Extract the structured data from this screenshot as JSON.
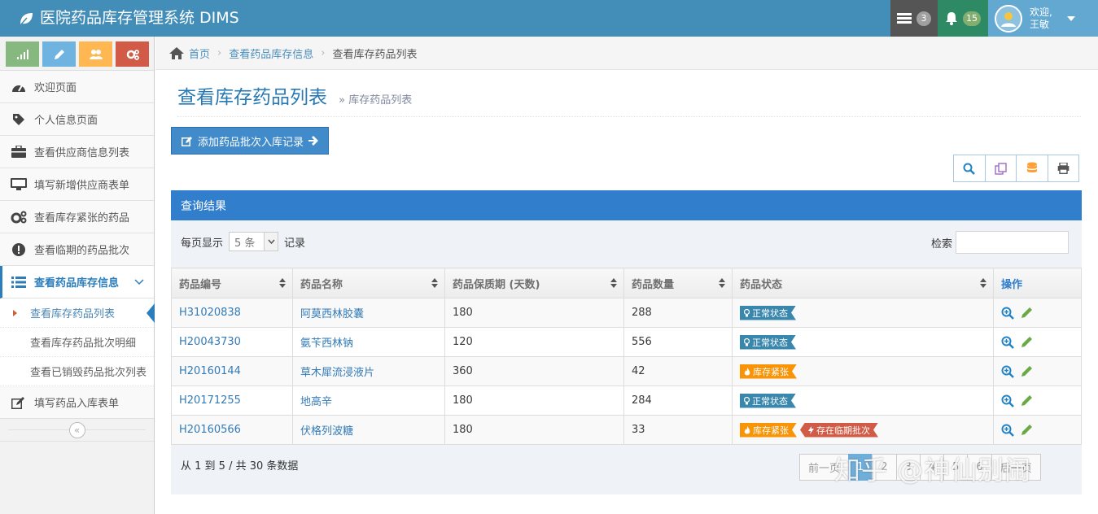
{
  "app": {
    "title": "医院药品库存管理系统 DIMS",
    "tasks_count": "3",
    "notifications_count": "15",
    "user_greeting": "欢迎,",
    "user_name": "王敏"
  },
  "sidebar": {
    "items": [
      {
        "label": "欢迎页面",
        "icon": "dashboard-icon"
      },
      {
        "label": "个人信息页面",
        "icon": "tag-icon"
      },
      {
        "label": "查看供应商信息列表",
        "icon": "briefcase-icon"
      },
      {
        "label": "填写新增供应商表单",
        "icon": "desktop-icon"
      },
      {
        "label": "查看库存紧张的药品",
        "icon": "cogs-icon"
      },
      {
        "label": "查看临期的药品批次",
        "icon": "exclamation-icon"
      },
      {
        "label": "查看药品库存信息",
        "icon": "list-icon"
      },
      {
        "label": "填写药品入库表单",
        "icon": "edit-icon"
      }
    ],
    "subitems": [
      {
        "label": "查看库存药品列表"
      },
      {
        "label": "查看库存药品批次明细"
      },
      {
        "label": "查看已销毁药品批次列表"
      }
    ],
    "collapse_glyph": "«"
  },
  "breadcrumb": {
    "home": "首页",
    "level1": "查看药品库存信息",
    "current": "查看库存药品列表"
  },
  "page": {
    "title": "查看库存药品列表",
    "subtitle": "» 库存药品列表",
    "add_button": "添加药品批次入库记录"
  },
  "panel": {
    "title": "查询结果",
    "length_prefix": "每页显示",
    "length_value": "5 条",
    "length_suffix": "记录",
    "search_label": "检索",
    "search_value": "",
    "info": "从 1 到 5 / 共 30 条数据"
  },
  "table": {
    "headers": [
      "药品编号",
      "药品名称",
      "药品保质期 (天数)",
      "药品数量",
      "药品状态",
      "操作"
    ],
    "rows": [
      {
        "code": "H31020838",
        "name": "阿莫西林胶囊",
        "shelf": "180",
        "qty": "288",
        "tags": [
          "正常状态"
        ]
      },
      {
        "code": "H20043730",
        "name": "氨苄西林钠",
        "shelf": "120",
        "qty": "556",
        "tags": [
          "正常状态"
        ]
      },
      {
        "code": "H20160144",
        "name": "草木犀流浸液片",
        "shelf": "360",
        "qty": "42",
        "tags": [
          "库存紧张"
        ]
      },
      {
        "code": "H20171255",
        "name": "地高辛",
        "shelf": "180",
        "qty": "284",
        "tags": [
          "正常状态"
        ]
      },
      {
        "code": "H20160566",
        "name": "伏格列波糖",
        "shelf": "180",
        "qty": "33",
        "tags": [
          "库存紧张",
          "存在临期批次"
        ]
      }
    ]
  },
  "pagination": {
    "prev": "前一页",
    "pages": [
      "1",
      "2",
      "3",
      "4",
      "5",
      "6"
    ],
    "next": "后一页"
  },
  "watermark": "知乎 @神仙别闹",
  "colors": {
    "navbar": "#438eb9",
    "accent": "#307ecc",
    "tag_normal": "#3a87ad",
    "tag_tight": "#f89406",
    "tag_expire": "#d15b47"
  }
}
